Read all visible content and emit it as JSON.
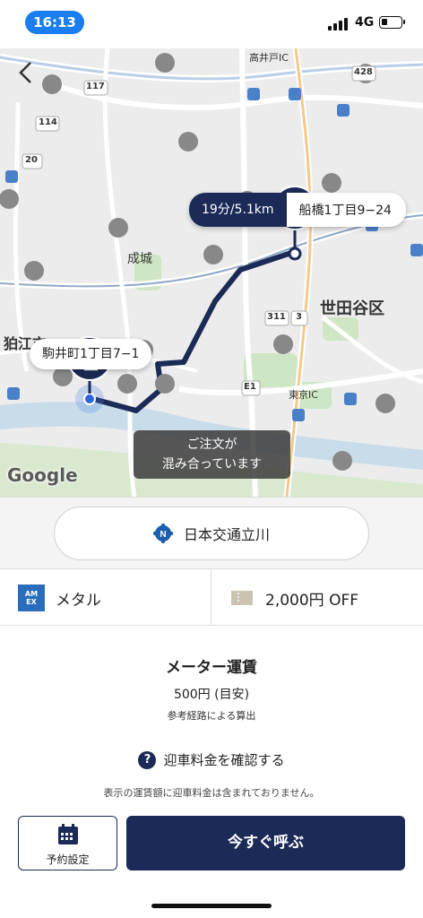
{
  "status_bar": {
    "time": "16:13",
    "network": "4G"
  },
  "map": {
    "labels": {
      "komae": "狛江市",
      "setagaya": "世田谷区",
      "seijo": "成城",
      "takaido_ic": "高井戸IC",
      "tokyo_ic": "東京IC",
      "r311": "311",
      "r3": "3",
      "r117": "117",
      "r114": "114",
      "r20": "20",
      "r428": "428",
      "e1": "E1"
    },
    "route_eta": "19分/5.1km",
    "destination": "船橋1丁目9−24",
    "origin": "駒井町1丁目7−1",
    "toast_line1": "ご注文が",
    "toast_line2": "混み合っています",
    "attribution": "Google"
  },
  "company": {
    "name": "日本交通立川"
  },
  "payment": {
    "card": "メタル",
    "coupon": "2,000円 OFF"
  },
  "fare": {
    "title": "メーター運賃",
    "amount": "500円 (目安)",
    "note": "参考経路による算出",
    "pickup_link": "迎車料金を確認する",
    "disclaimer": "表示の運賃額に迎車料金は含まれておりません。"
  },
  "actions": {
    "reserve": "予約設定",
    "call_now": "今すぐ呼ぶ"
  },
  "colors": {
    "accent": "#1b2a56",
    "time_pill": "#1a7ef0",
    "amex": "#2a6ebb"
  }
}
